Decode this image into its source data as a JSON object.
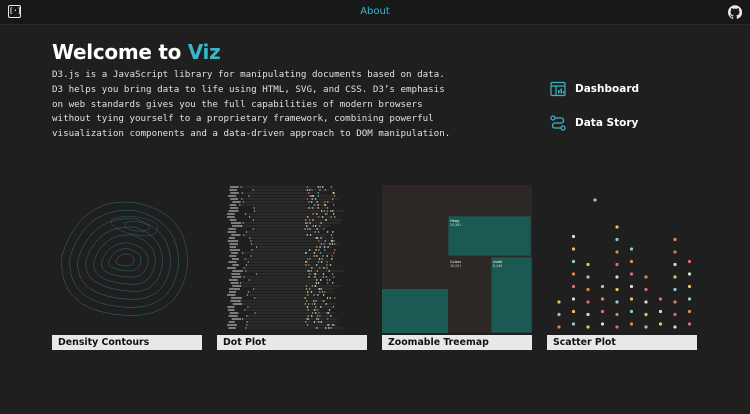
{
  "topbar": {
    "logo_icon": "bracket-logo-icon",
    "about_label": "About",
    "github_icon": "github-icon"
  },
  "hero": {
    "title_prefix": "Welcome to ",
    "title_accent": "Viz",
    "intro": "D3.js is a JavaScript library for manipulating documents based on data. D3 helps you bring data to life using HTML, SVG, and CSS. D3’s emphasis on web standards gives you the full capabilities of modern browsers without tying yourself to a proprietary framework, combining powerful visualization components and a data-driven approach to DOM manipulation."
  },
  "side_links": [
    {
      "label": "Dashboard",
      "icon": "dashboard-icon"
    },
    {
      "label": "Data Story",
      "icon": "data-story-icon"
    }
  ],
  "cards": [
    {
      "label": "Density Contours"
    },
    {
      "label": "Dot Plot"
    },
    {
      "label": "Zoomable Treemap"
    },
    {
      "label": "Scatter Plot"
    }
  ],
  "treemap": {
    "cells": [
      {
        "name": "Heap",
        "value": "10,561"
      },
      {
        "name": "Colors",
        "value": "10,001"
      },
      {
        "name": "math",
        "value": "6,446"
      }
    ]
  },
  "colors": {
    "accent": "#3ab6c9",
    "background": "#1f1f1f",
    "treemap_teal": "#1a5a52",
    "treemap_bg": "#2d2826",
    "label_bg": "#e8e8e8"
  }
}
